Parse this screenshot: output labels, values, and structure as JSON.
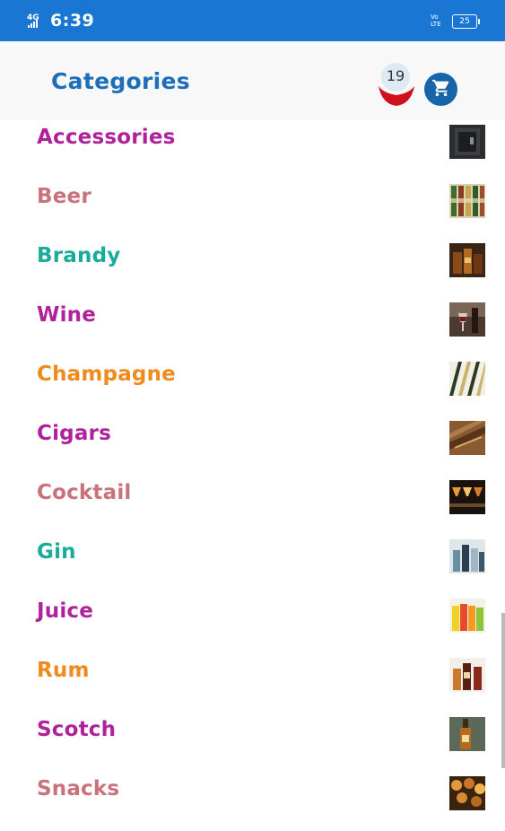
{
  "status_bar": {
    "time": "6:39",
    "network": "4G",
    "volte": "VoLTE",
    "battery": "25"
  },
  "header": {
    "title": "Categories",
    "notification_count": "19"
  },
  "categories": [
    {
      "label": "Accessories",
      "color": "#b0219c",
      "thumb": "accessories-thumbnail"
    },
    {
      "label": "Beer",
      "color": "#c8737c",
      "thumb": "beer-thumbnail"
    },
    {
      "label": "Brandy",
      "color": "#1aab9b",
      "thumb": "brandy-thumbnail"
    },
    {
      "label": "Wine",
      "color": "#b0219c",
      "thumb": "wine-thumbnail"
    },
    {
      "label": "Champagne",
      "color": "#ef8a1c",
      "thumb": "champagne-thumbnail"
    },
    {
      "label": "Cigars",
      "color": "#b0219c",
      "thumb": "cigars-thumbnail"
    },
    {
      "label": "Cocktail",
      "color": "#c8737c",
      "thumb": "cocktail-thumbnail"
    },
    {
      "label": "Gin",
      "color": "#1aab9b",
      "thumb": "gin-thumbnail"
    },
    {
      "label": "Juice",
      "color": "#b0219c",
      "thumb": "juice-thumbnail"
    },
    {
      "label": "Rum",
      "color": "#ef8a1c",
      "thumb": "rum-thumbnail"
    },
    {
      "label": "Scotch",
      "color": "#b0219c",
      "thumb": "scotch-thumbnail"
    },
    {
      "label": "Snacks",
      "color": "#c8737c",
      "thumb": "snacks-thumbnail"
    }
  ],
  "colors": {
    "status_bar": "#1976d2",
    "title": "#1c6fb8",
    "cart": "#1565a8",
    "notification": "#d0101f"
  }
}
